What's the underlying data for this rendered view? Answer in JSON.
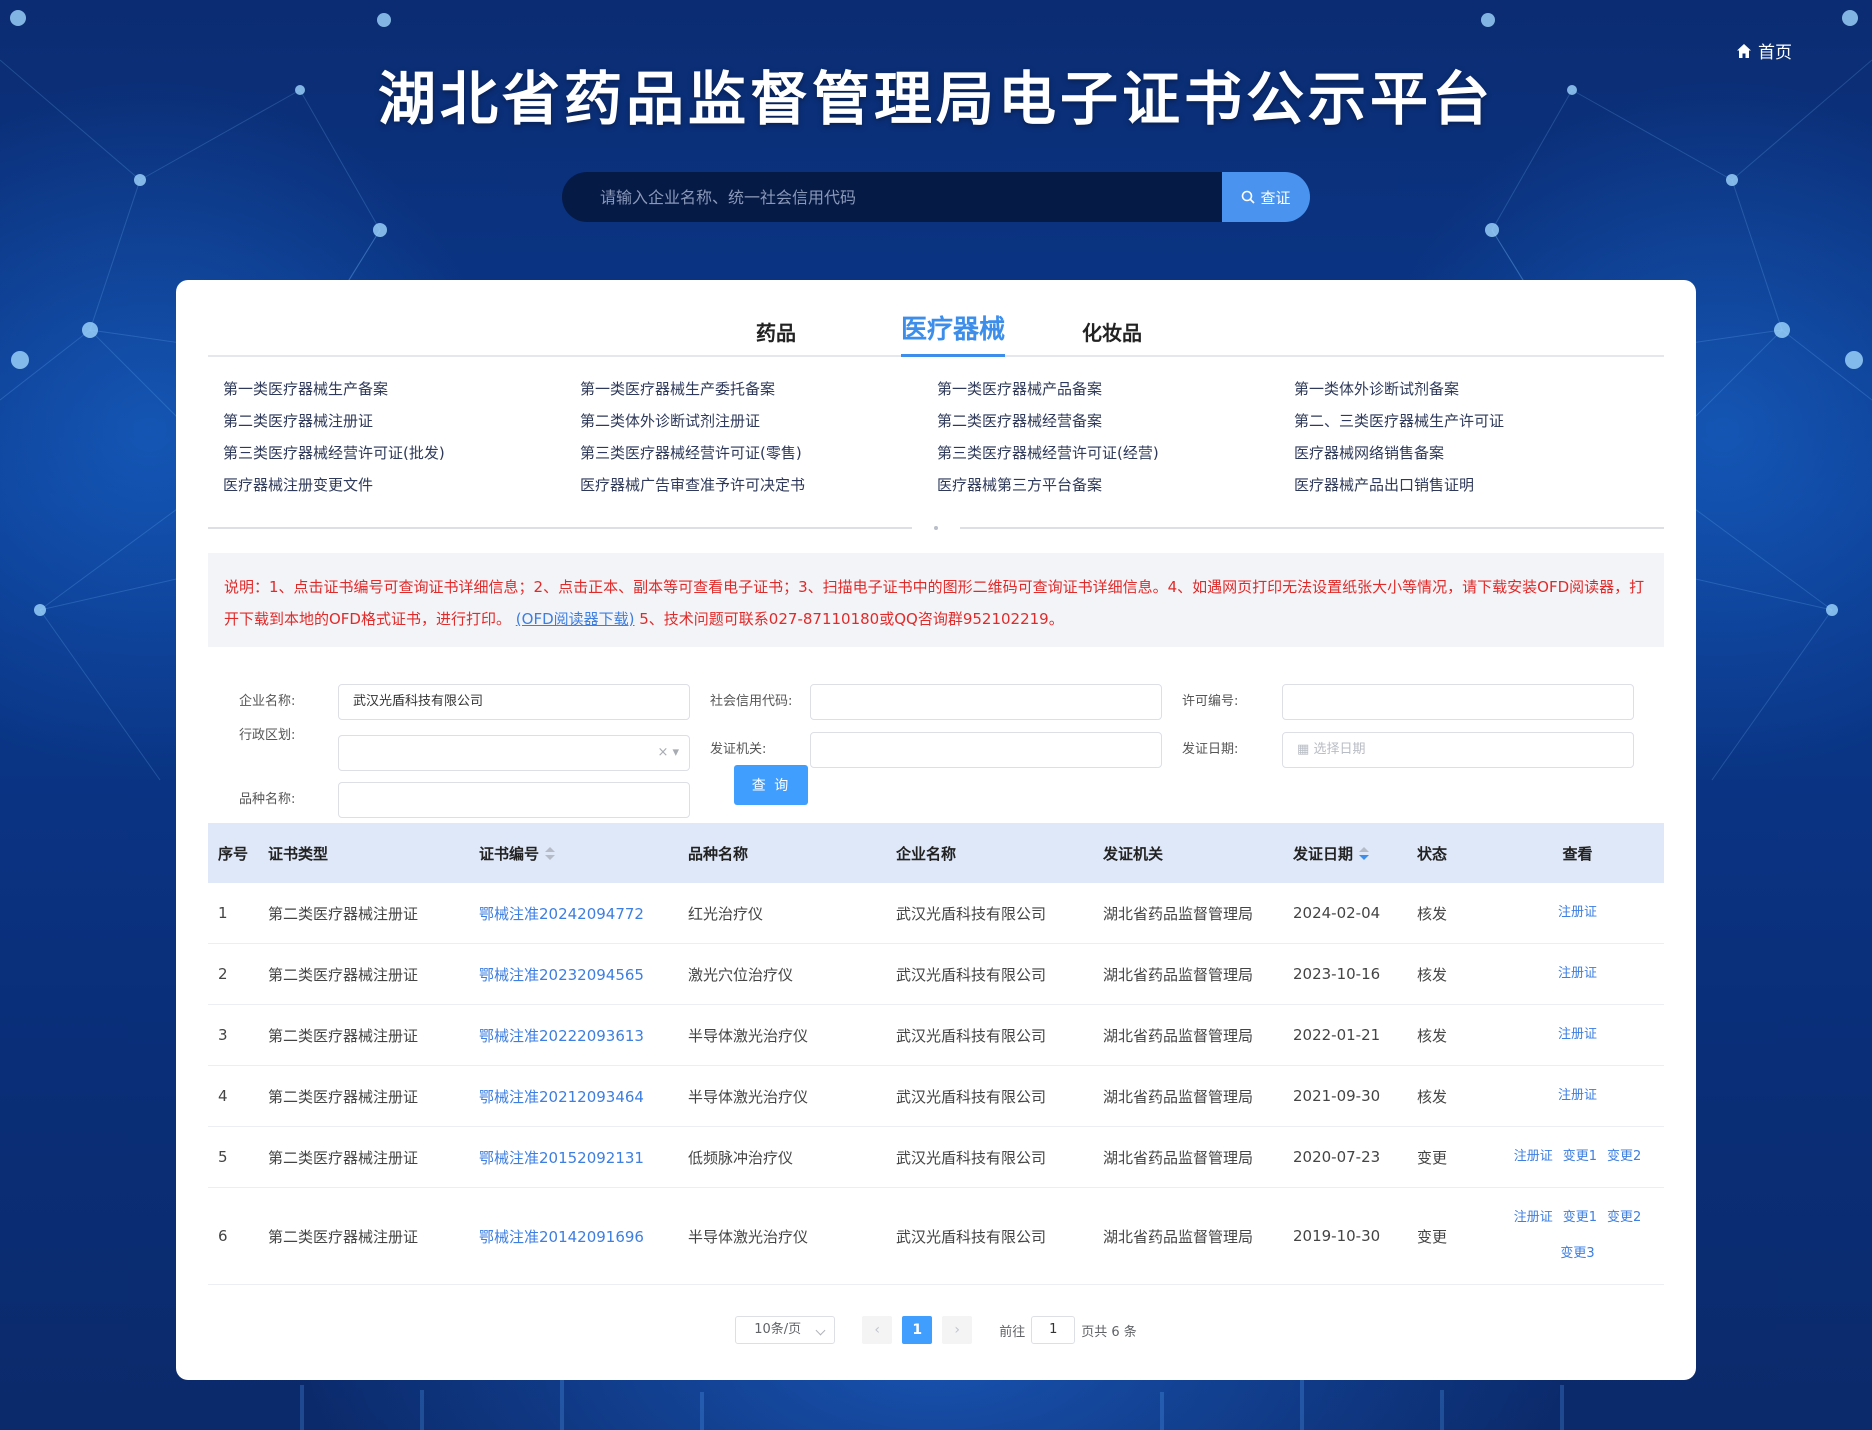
{
  "header": {
    "home_label": "首页",
    "title": "湖北省药品监督管理局电子证书公示平台"
  },
  "search": {
    "placeholder": "请输入企业名称、统一社会信用代码",
    "button_label": "查证"
  },
  "tabs": [
    {
      "label": "药品",
      "active": false
    },
    {
      "label": "医疗器械",
      "active": true
    },
    {
      "label": "化妆品",
      "active": false
    }
  ],
  "categories": [
    "第一类医疗器械生产备案",
    "第一类医疗器械生产委托备案",
    "第一类医疗器械产品备案",
    "第一类体外诊断试剂备案",
    "第二类医疗器械注册证",
    "第二类体外诊断试剂注册证",
    "第二类医疗器械经营备案",
    "第二、三类医疗器械生产许可证",
    "第三类医疗器械经营许可证(批发)",
    "第三类医疗器械经营许可证(零售)",
    "第三类医疗器械经营许可证(经营)",
    "医疗器械网络销售备案",
    "医疗器械注册变更文件",
    "医疗器械广告审查准予许可决定书",
    "医疗器械第三方平台备案",
    "医疗器械产品出口销售证明"
  ],
  "notice": {
    "text_before": "说明：1、点击证书编号可查询证书详细信息；2、点击正本、副本等可查看电子证书；3、扫描电子证书中的图形二维码可查询证书详细信息。4、如遇网页打印无法设置纸张大小等情况，请下载安装OFD阅读器，打开下载到本地的OFD格式证书，进行打印。",
    "link_text": "(OFD阅读器下载)",
    "text_after": "5、技术问题可联系027-87110180或QQ咨询群952102219。"
  },
  "form": {
    "company_label": "企业名称:",
    "company_value": "武汉光盾科技有限公司",
    "credit_label": "社会信用代码:",
    "credit_value": "",
    "license_label": "许可编号:",
    "license_value": "",
    "region_label": "行政区划:",
    "region_value": "",
    "issuer_label": "发证机关:",
    "issuer_value": "",
    "date_label": "发证日期:",
    "date_placeholder": "选择日期",
    "variety_label": "品种名称:",
    "variety_value": "",
    "query_label": "查 询"
  },
  "table": {
    "headers": [
      "序号",
      "证书类型",
      "证书编号",
      "品种名称",
      "企业名称",
      "发证机关",
      "发证日期",
      "状态",
      "查看"
    ],
    "rows": [
      {
        "no": "1",
        "type": "第二类医疗器械注册证",
        "cert": "鄂械注准20242094772",
        "variety": "红光治疗仪",
        "company": "武汉光盾科技有限公司",
        "issuer": "湖北省药品监督管理局",
        "date": "2024-02-04",
        "status": "核发",
        "links": [
          "注册证"
        ]
      },
      {
        "no": "2",
        "type": "第二类医疗器械注册证",
        "cert": "鄂械注准20232094565",
        "variety": "激光穴位治疗仪",
        "company": "武汉光盾科技有限公司",
        "issuer": "湖北省药品监督管理局",
        "date": "2023-10-16",
        "status": "核发",
        "links": [
          "注册证"
        ]
      },
      {
        "no": "3",
        "type": "第二类医疗器械注册证",
        "cert": "鄂械注准20222093613",
        "variety": "半导体激光治疗仪",
        "company": "武汉光盾科技有限公司",
        "issuer": "湖北省药品监督管理局",
        "date": "2022-01-21",
        "status": "核发",
        "links": [
          "注册证"
        ]
      },
      {
        "no": "4",
        "type": "第二类医疗器械注册证",
        "cert": "鄂械注准20212093464",
        "variety": "半导体激光治疗仪",
        "company": "武汉光盾科技有限公司",
        "issuer": "湖北省药品监督管理局",
        "date": "2021-09-30",
        "status": "核发",
        "links": [
          "注册证"
        ]
      },
      {
        "no": "5",
        "type": "第二类医疗器械注册证",
        "cert": "鄂械注准20152092131",
        "variety": "低频脉冲治疗仪",
        "company": "武汉光盾科技有限公司",
        "issuer": "湖北省药品监督管理局",
        "date": "2020-07-23",
        "status": "变更",
        "links": [
          "注册证",
          "变更1",
          "变更2"
        ]
      },
      {
        "no": "6",
        "type": "第二类医疗器械注册证",
        "cert": "鄂械注准20142091696",
        "variety": "半导体激光治疗仪",
        "company": "武汉光盾科技有限公司",
        "issuer": "湖北省药品监督管理局",
        "date": "2019-10-30",
        "status": "变更",
        "links": [
          "注册证",
          "变更1",
          "变更2",
          "变更3"
        ]
      }
    ]
  },
  "pagination": {
    "page_size": "10条/页",
    "prev": "‹",
    "current": "1",
    "next": "›",
    "goto_label": "前往",
    "goto_value": "1",
    "total_label": "页共 6 条"
  },
  "colors": {
    "accent": "#409eff",
    "link": "#3d7ee0",
    "notice": "#e02a2a",
    "header_bg": "#dfe8f8"
  }
}
